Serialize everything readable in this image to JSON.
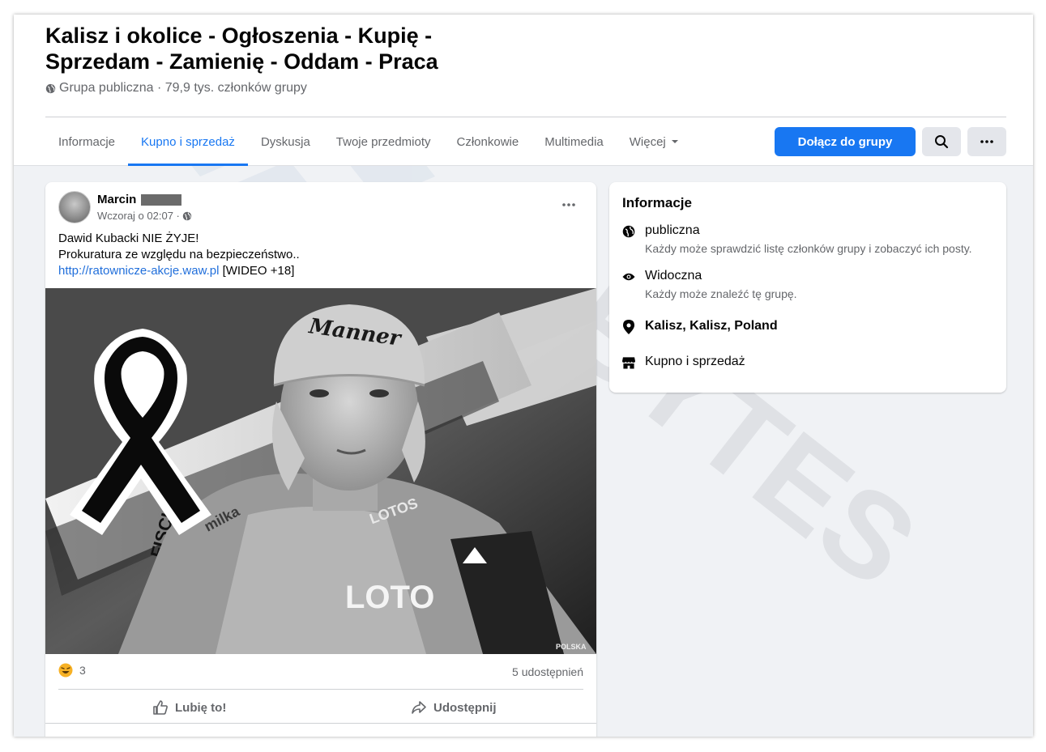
{
  "group": {
    "title": "Kalisz i okolice - Ogłoszenia - Kupię - Sprzedam - Zamienię - Oddam - Praca",
    "meta": "Grupa publiczna · 79,9 tys. członków grupy"
  },
  "tabs": [
    {
      "label": "Informacje"
    },
    {
      "label": "Kupno i sprzedaż",
      "active": true
    },
    {
      "label": "Dyskusja"
    },
    {
      "label": "Twoje przedmioty"
    },
    {
      "label": "Członkowie"
    },
    {
      "label": "Multimedia"
    },
    {
      "label": "Więcej"
    }
  ],
  "actions": {
    "join_label": "Dołącz do grupy",
    "search_icon": "search-icon",
    "more_icon": "more-icon"
  },
  "post": {
    "author": "Marcin",
    "time": "Wczoraj o 02:07 ·",
    "line1": "Dawid Kubacki NIE ŻYJE!",
    "line2": "Prokuratura ze względu na bezpieczeństwo..",
    "link": "http://ratownicze-akcje.waw.pl",
    "link_suffix": "[WIDEO +18]",
    "reaction_count": "3",
    "shares": "5 udostępnień",
    "like_label": "Lubię to!",
    "share_label": "Udostępnij",
    "photo_text": {
      "hat": "Manner",
      "brand": "FISCHER",
      "jacket": "LOTO",
      "jacket2": "LOTOS",
      "country": "POLSKA",
      "ski": "milka"
    }
  },
  "info": {
    "title": "Informacje",
    "rows": [
      {
        "icon": "globe-icon",
        "title": "publiczna",
        "desc": "Każdy może sprawdzić listę członków grupy i zobaczyć ich posty."
      },
      {
        "icon": "eye-icon",
        "title": "Widoczna",
        "desc": "Każdy może znaleźć tę grupę."
      },
      {
        "icon": "location-pin-icon",
        "title": "Kalisz, Kalisz, Poland"
      },
      {
        "icon": "shop-icon",
        "title": "Kupno i sprzedaż"
      }
    ]
  },
  "colors": {
    "accent": "#1877f2",
    "link": "#216fdb",
    "background": "#f0f2f5",
    "secondary_text": "#65676b"
  }
}
